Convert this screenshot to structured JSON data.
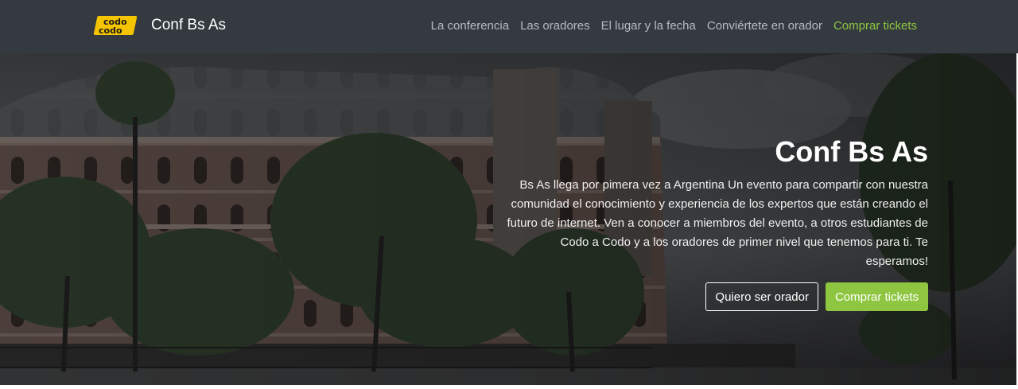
{
  "navbar": {
    "logo": {
      "line1": "codo",
      "line2": "codo"
    },
    "brand": "Conf Bs As",
    "links": [
      {
        "label": "La conferencia"
      },
      {
        "label": "Las oradores"
      },
      {
        "label": "El lugar y la fecha"
      },
      {
        "label": "Conviértete en orador"
      },
      {
        "label": "Comprar tickets"
      }
    ],
    "accent_color": "#8ec641",
    "background_color": "#343a40"
  },
  "hero": {
    "title": "Conf Bs As",
    "text": "Bs As llega por pimera vez a Argentina Un evento para compartir con nuestra comunidad el conocimiento y experiencia de los expertos que están creando el futuro de internet. Ven a conocer a miembros del evento, a otros estudiantes de Codo a Codo y a los oradores de primer nivel que tenemos para ti. Te esperamos!",
    "buttons": {
      "speaker": "Quiero ser orador",
      "tickets": "Comprar tickets"
    },
    "background_image": "dark-building-with-trees"
  }
}
